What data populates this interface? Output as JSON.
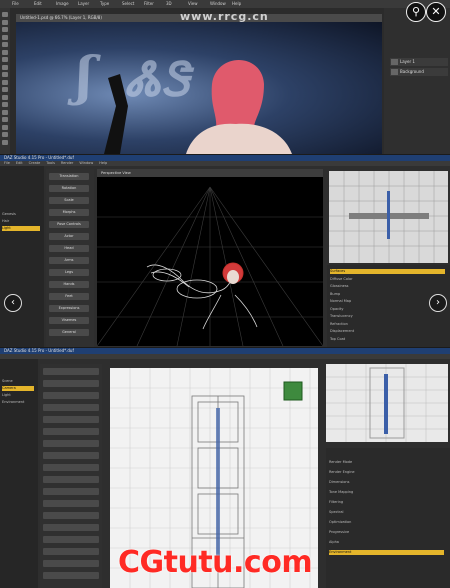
{
  "watermark_top": "www.rrcg.cn",
  "brand_logo": "CGtutu.com",
  "top_controls": {
    "zoom_icon": "search-icon",
    "close_icon": "close-icon"
  },
  "nav": {
    "prev": "‹",
    "next": "›"
  },
  "ps": {
    "menu": [
      "File",
      "Edit",
      "Image",
      "Layer",
      "Type",
      "Select",
      "Filter",
      "3D",
      "View",
      "Window",
      "Help"
    ],
    "doc_tab": "Untitled-1.psd @ 66.7% (Layer 1, RGB/8)",
    "layers": [
      "Layer 1",
      "Background"
    ]
  },
  "daz1": {
    "title": "DAZ Studio 4.15 Pro - Untitled*.duf",
    "menu": [
      "File",
      "Edit",
      "Create",
      "Tools",
      "Render",
      "Window",
      "Help"
    ],
    "scene_items": [
      "Genesis",
      "Hair",
      "Light"
    ],
    "viewport_label": "Perspective View",
    "params": [
      "Translation",
      "Rotation",
      "Scale",
      "Morphs",
      "Pose Controls",
      "Actor",
      "Head",
      "Arms",
      "Legs",
      "Hands",
      "Feet",
      "Expressions",
      "Visemes",
      "General"
    ],
    "props": [
      "Surfaces",
      "Diffuse Color",
      "Glossiness",
      "Bump",
      "Normal Map",
      "Opacity",
      "Translucency",
      "Refraction",
      "Displacement",
      "Top Coat"
    ],
    "selected_prop": "Surfaces"
  },
  "daz2": {
    "title": "DAZ Studio 4.15 Pro - Untitled*.duf",
    "scene_items": [
      "Scene",
      "Camera",
      "Light",
      "Environment"
    ],
    "selected_scene": "Camera",
    "props": [
      "Render Mode",
      "Render Engine",
      "Dimensions",
      "Tone Mapping",
      "Filtering",
      "Spectral",
      "Optimization",
      "Progressive",
      "Alpha",
      "Environment"
    ],
    "selected_prop": "Environment"
  }
}
